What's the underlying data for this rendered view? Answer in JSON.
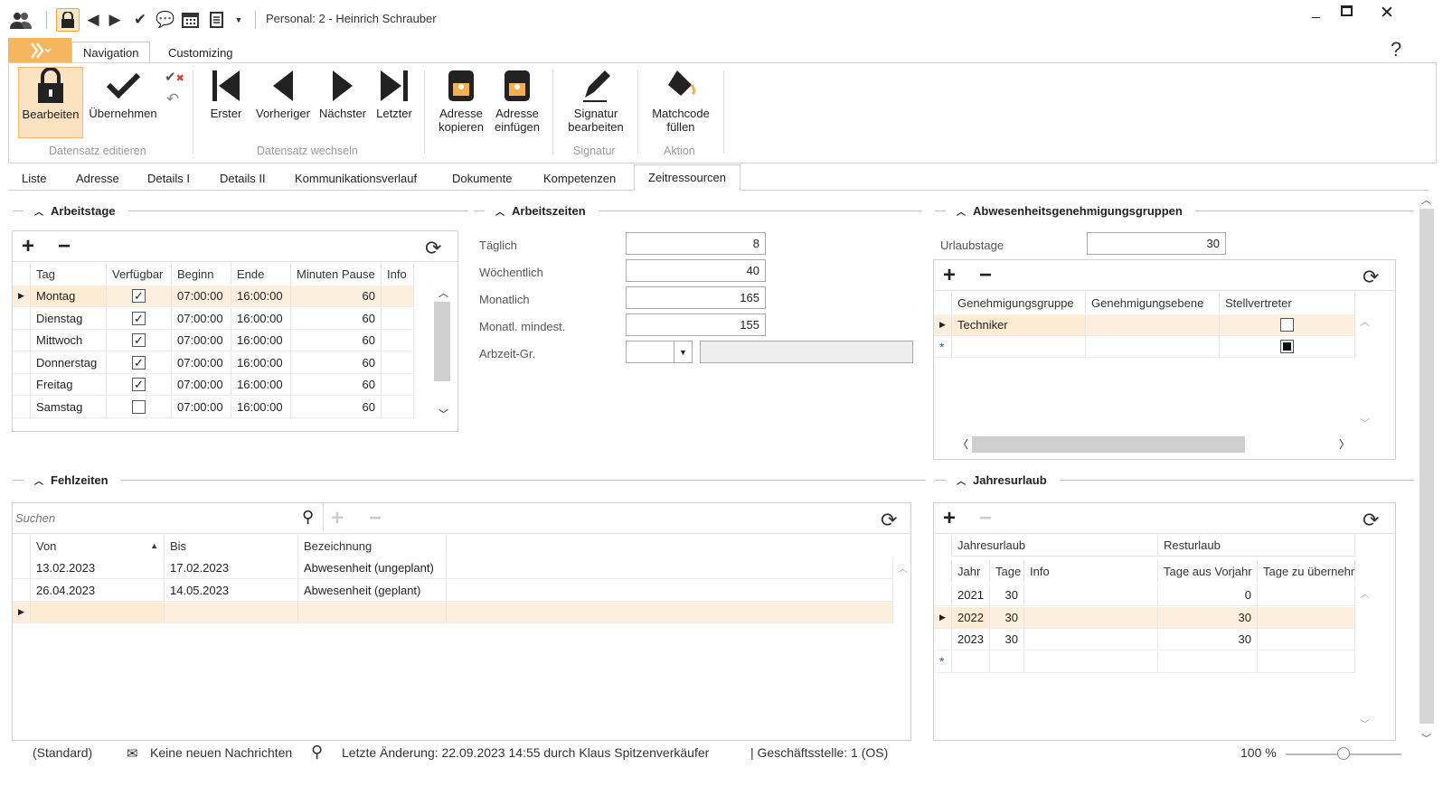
{
  "window": {
    "title": "Personal: 2 - Heinrich Schrauber",
    "controls": [
      "minimize-icon",
      "maximize-icon",
      "close-icon"
    ],
    "help": "?"
  },
  "ribbon": {
    "tabs": [
      "Navigation",
      "Customizing"
    ],
    "buttons": {
      "bearbeiten": "Bearbeiten",
      "uebernehmen": "Übernehmen",
      "erster": "Erster",
      "vorheriger": "Vorheriger",
      "naechster": "Nächster",
      "letzter": "Letzter",
      "adresse_kopieren_1": "Adresse",
      "adresse_kopieren_2": "kopieren",
      "adresse_einfuegen_1": "Adresse",
      "adresse_einfuegen_2": "einfügen",
      "signatur_1": "Signatur",
      "signatur_2": "bearbeiten",
      "matchcode_1": "Matchcode",
      "matchcode_2": "füllen"
    },
    "groups": {
      "edit": "Datensatz editieren",
      "switch": "Datensatz wechseln",
      "signatur": "Signatur",
      "aktion": "Aktion"
    }
  },
  "main_tabs": [
    "Liste",
    "Adresse",
    "Details I",
    "Details II",
    "Kommunikationsverlauf",
    "Dokumente",
    "Kompetenzen",
    "Zeitressourcen"
  ],
  "arbeitstage": {
    "title": "Arbeitstage",
    "columns": [
      "Tag",
      "Verfügbar",
      "Beginn",
      "Ende",
      "Minuten Pause",
      "Info"
    ],
    "rows": [
      {
        "tag": "Montag",
        "verfuegbar": true,
        "beginn": "07:00:00",
        "ende": "16:00:00",
        "pause": "60"
      },
      {
        "tag": "Dienstag",
        "verfuegbar": true,
        "beginn": "07:00:00",
        "ende": "16:00:00",
        "pause": "60"
      },
      {
        "tag": "Mittwoch",
        "verfuegbar": true,
        "beginn": "07:00:00",
        "ende": "16:00:00",
        "pause": "60"
      },
      {
        "tag": "Donnerstag",
        "verfuegbar": true,
        "beginn": "07:00:00",
        "ende": "16:00:00",
        "pause": "60"
      },
      {
        "tag": "Freitag",
        "verfuegbar": true,
        "beginn": "07:00:00",
        "ende": "16:00:00",
        "pause": "60"
      },
      {
        "tag": "Samstag",
        "verfuegbar": false,
        "beginn": "07:00:00",
        "ende": "16:00:00",
        "pause": "60"
      }
    ]
  },
  "arbeitszeiten": {
    "title": "Arbeitszeiten",
    "taeglich_label": "Täglich",
    "taeglich": "8",
    "woechentlich_label": "Wöchentlich",
    "woechentlich": "40",
    "monatlich_label": "Monatlich",
    "monatlich": "165",
    "monatl_min_label": "Monatl. mindest.",
    "monatl_min": "155",
    "arbzeit_label": "Arbzeit-Gr."
  },
  "abwesenheit": {
    "title": "Abwesenheitsgenehmigungsgruppen",
    "urlaubstage_label": "Urlaubstage",
    "urlaubstage": "30",
    "columns": [
      "Genehmigungsgruppe",
      "Genehmigungsebene",
      "Stellvertreter"
    ],
    "rows": [
      {
        "gruppe": "Techniker",
        "ebene": "",
        "stellvertreter": false
      }
    ]
  },
  "fehlzeiten": {
    "title": "Fehlzeiten",
    "search_placeholder": "Suchen",
    "columns": [
      "Von",
      "Bis",
      "Bezeichnung"
    ],
    "rows": [
      {
        "von": "13.02.2023",
        "bis": "17.02.2023",
        "bez": "Abwesenheit (ungeplant)"
      },
      {
        "von": "26.04.2023",
        "bis": "14.05.2023",
        "bez": "Abwesenheit (geplant)"
      }
    ]
  },
  "jahresurlaub": {
    "title": "Jahresurlaub",
    "band1": "Jahresurlaub",
    "band2": "Resturlaub",
    "columns": [
      "Jahr",
      "Tage",
      "Info",
      "Tage aus Vorjahr",
      "Tage zu übernehmen"
    ],
    "rows": [
      {
        "jahr": "2021",
        "tage": "30",
        "vorjahr": "0"
      },
      {
        "jahr": "2022",
        "tage": "30",
        "vorjahr": "30"
      },
      {
        "jahr": "2023",
        "tage": "30",
        "vorjahr": "30"
      }
    ]
  },
  "status": {
    "layout": "(Standard)",
    "messages": "Keine neuen Nachrichten",
    "last_change": "Letzte Änderung: 22.09.2023 14:55 durch Klaus Spitzenverkäufer",
    "branch": "| Geschäftsstelle:  1 (OS)",
    "zoom": "100 %",
    "zoom_level": 100
  }
}
